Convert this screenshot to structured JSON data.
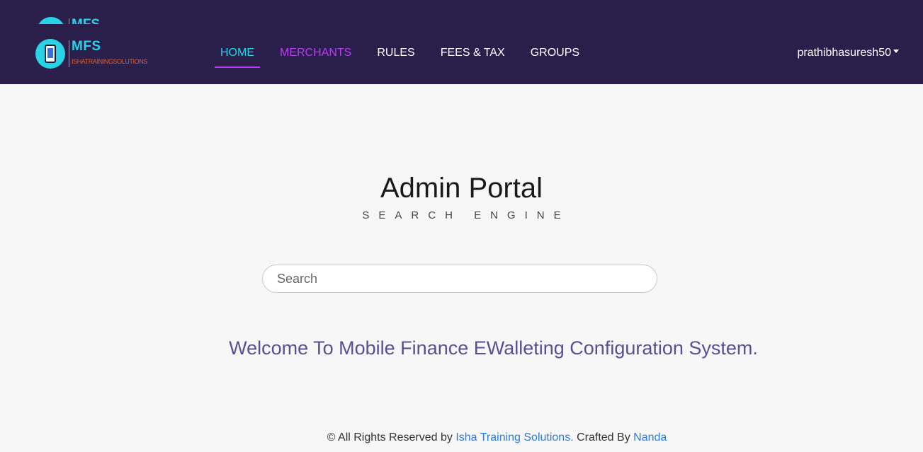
{
  "brand": {
    "name": "MFS",
    "subtitle": "ISHATRAININGSOLUTIONS",
    "icon": "phone-icon"
  },
  "nav": {
    "items": [
      {
        "label": "HOME"
      },
      {
        "label": "MERCHANTS"
      },
      {
        "label": "RULES"
      },
      {
        "label": "FEES & TAX"
      },
      {
        "label": "GROUPS"
      }
    ],
    "active": "HOME",
    "hover": "MERCHANTS"
  },
  "user": {
    "name": "prathibhasuresh50"
  },
  "main": {
    "title": "Admin Portal",
    "subtitle": "SEARCH ENGINE",
    "search_placeholder": "Search",
    "welcome": "Welcome To Mobile Finance EWalleting Configuration System."
  },
  "footer": {
    "prefix": "© All Rights Reserved by",
    "company": "Isha Training Solutions.",
    "crafted_by": "Crafted By",
    "author": "Nanda"
  },
  "colors": {
    "navbar_bg": "#2a1f4b",
    "accent_cyan": "#29d3e6",
    "accent_purple": "#b63ef0",
    "welcome_text": "#5a4f94",
    "link": "#2f7bd8"
  }
}
